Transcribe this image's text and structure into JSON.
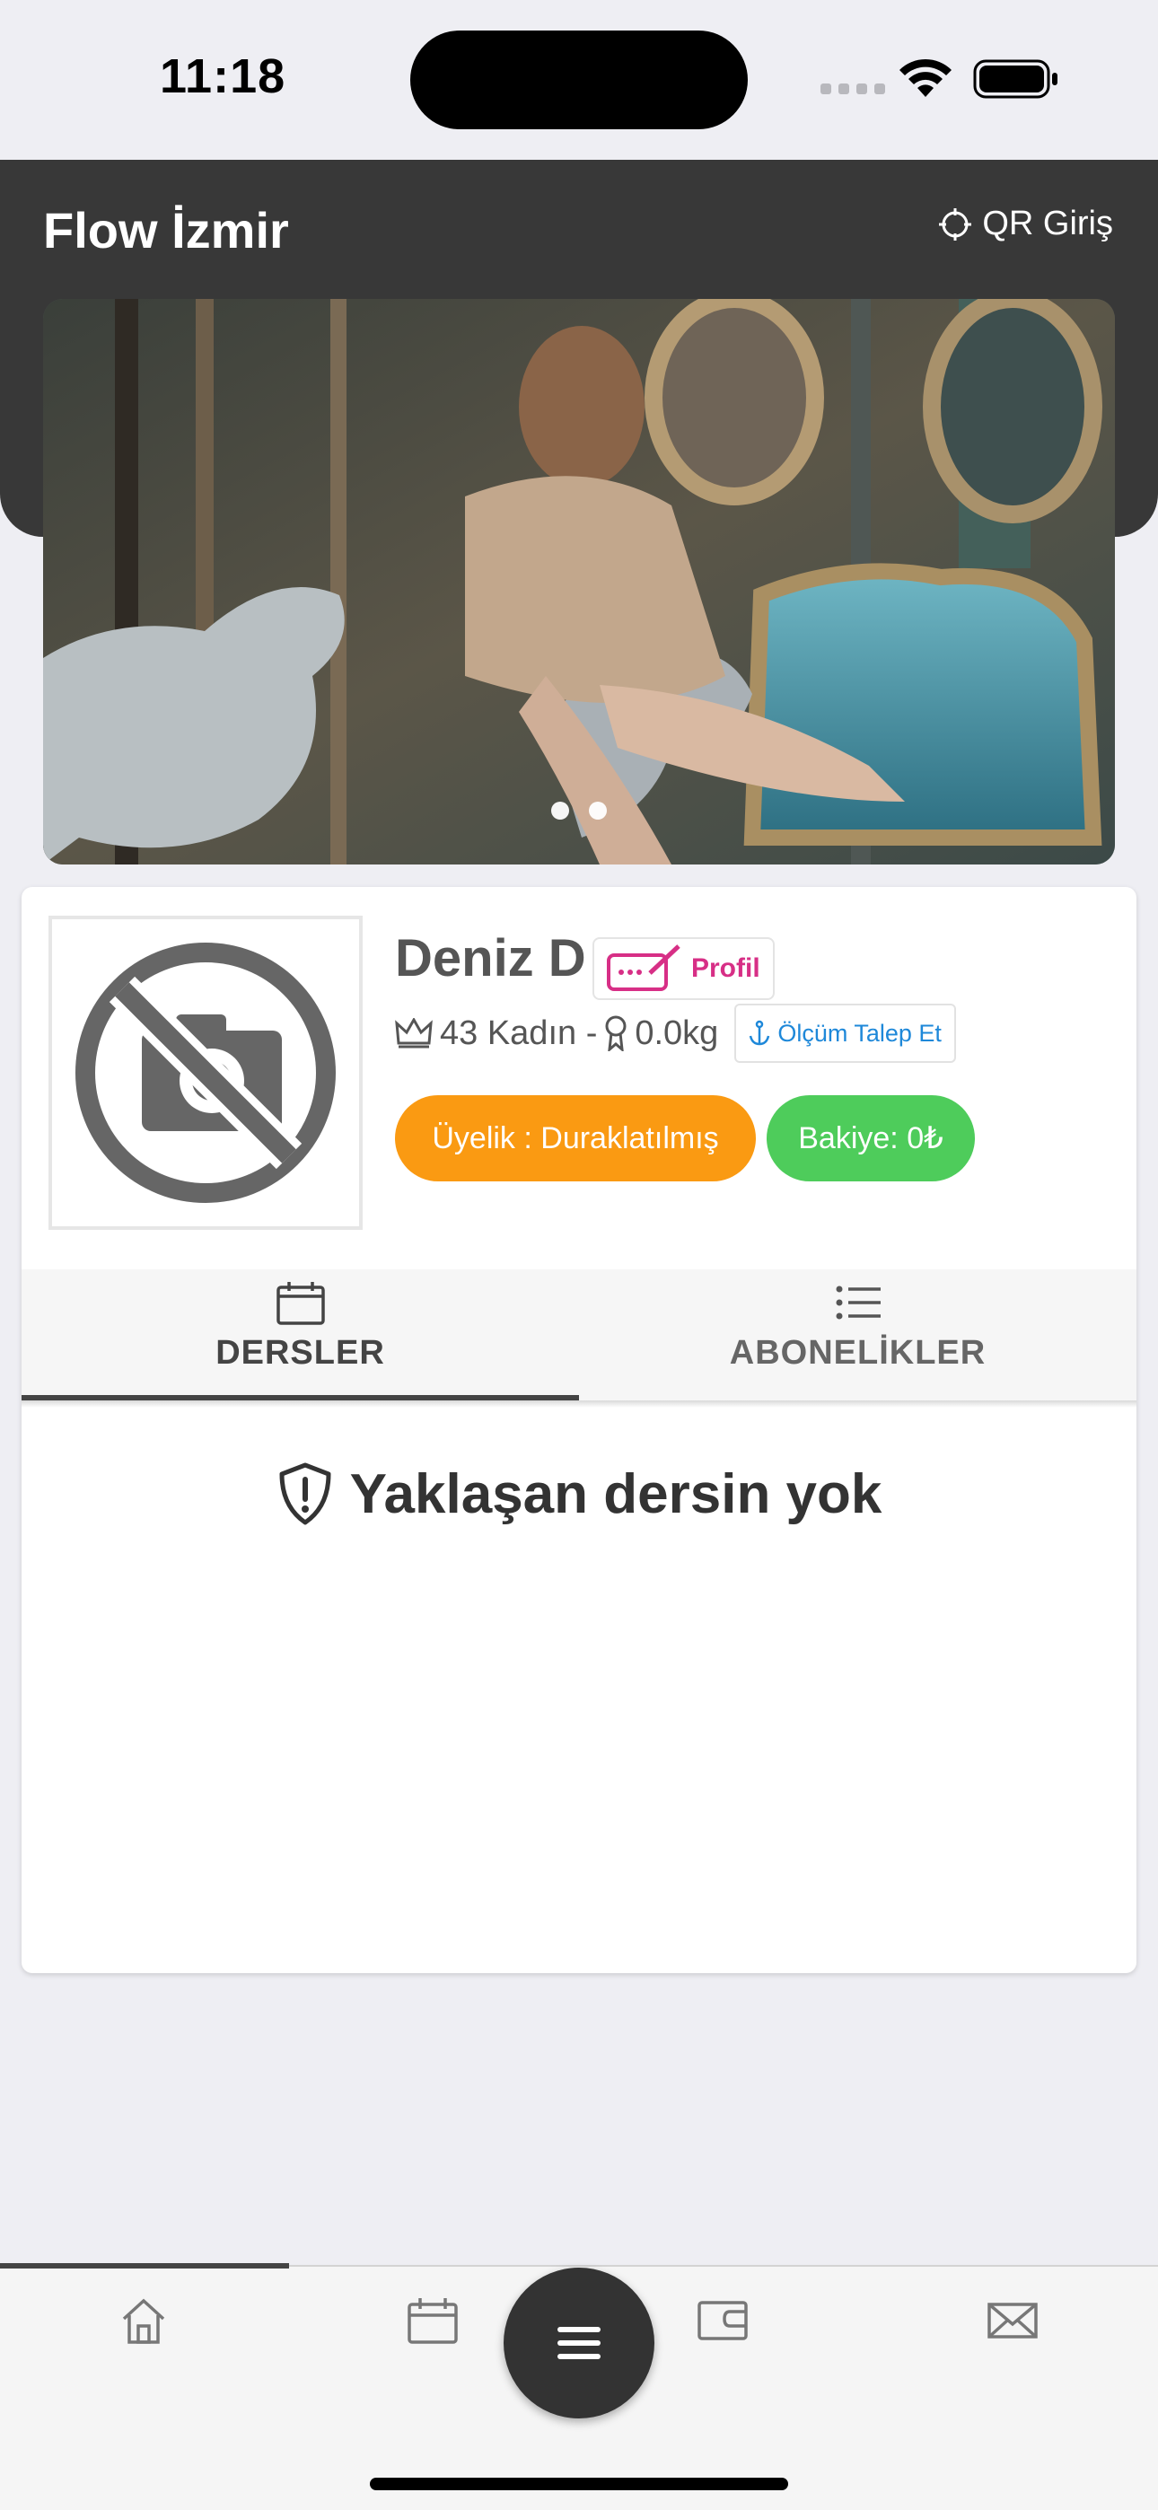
{
  "status": {
    "time": "11:18"
  },
  "header": {
    "title": "Flow İzmir",
    "qr_label": "QR Giriş"
  },
  "carousel": {
    "slide_count": 2,
    "active_slide": 1
  },
  "profile": {
    "name": "Deniz D",
    "profile_button": "Profil",
    "meta_text": "43 Kadın -",
    "weight": "0.0kg",
    "measure_button": "Ölçüm Talep Et",
    "membership": "Üyelik : Duraklatılmış",
    "balance": "Bakiye: 0₺"
  },
  "tabs": [
    {
      "label": "DERSLER",
      "icon": "calendar-icon",
      "active": true
    },
    {
      "label": "ABONELİKLER",
      "icon": "list-icon",
      "active": false
    }
  ],
  "empty_state": {
    "message": "Yaklaşan dersin yok",
    "icon": "shield-alert-icon"
  },
  "bottom_nav": {
    "items": [
      "home-icon",
      "calendar-icon",
      "menu-icon",
      "wallet-icon",
      "mail-icon"
    ],
    "active": "home-icon"
  },
  "colors": {
    "header": "#383838",
    "orange": "#fa9a12",
    "green": "#4ecc5b",
    "pink": "#d72f86",
    "blue": "#1e88d9"
  }
}
